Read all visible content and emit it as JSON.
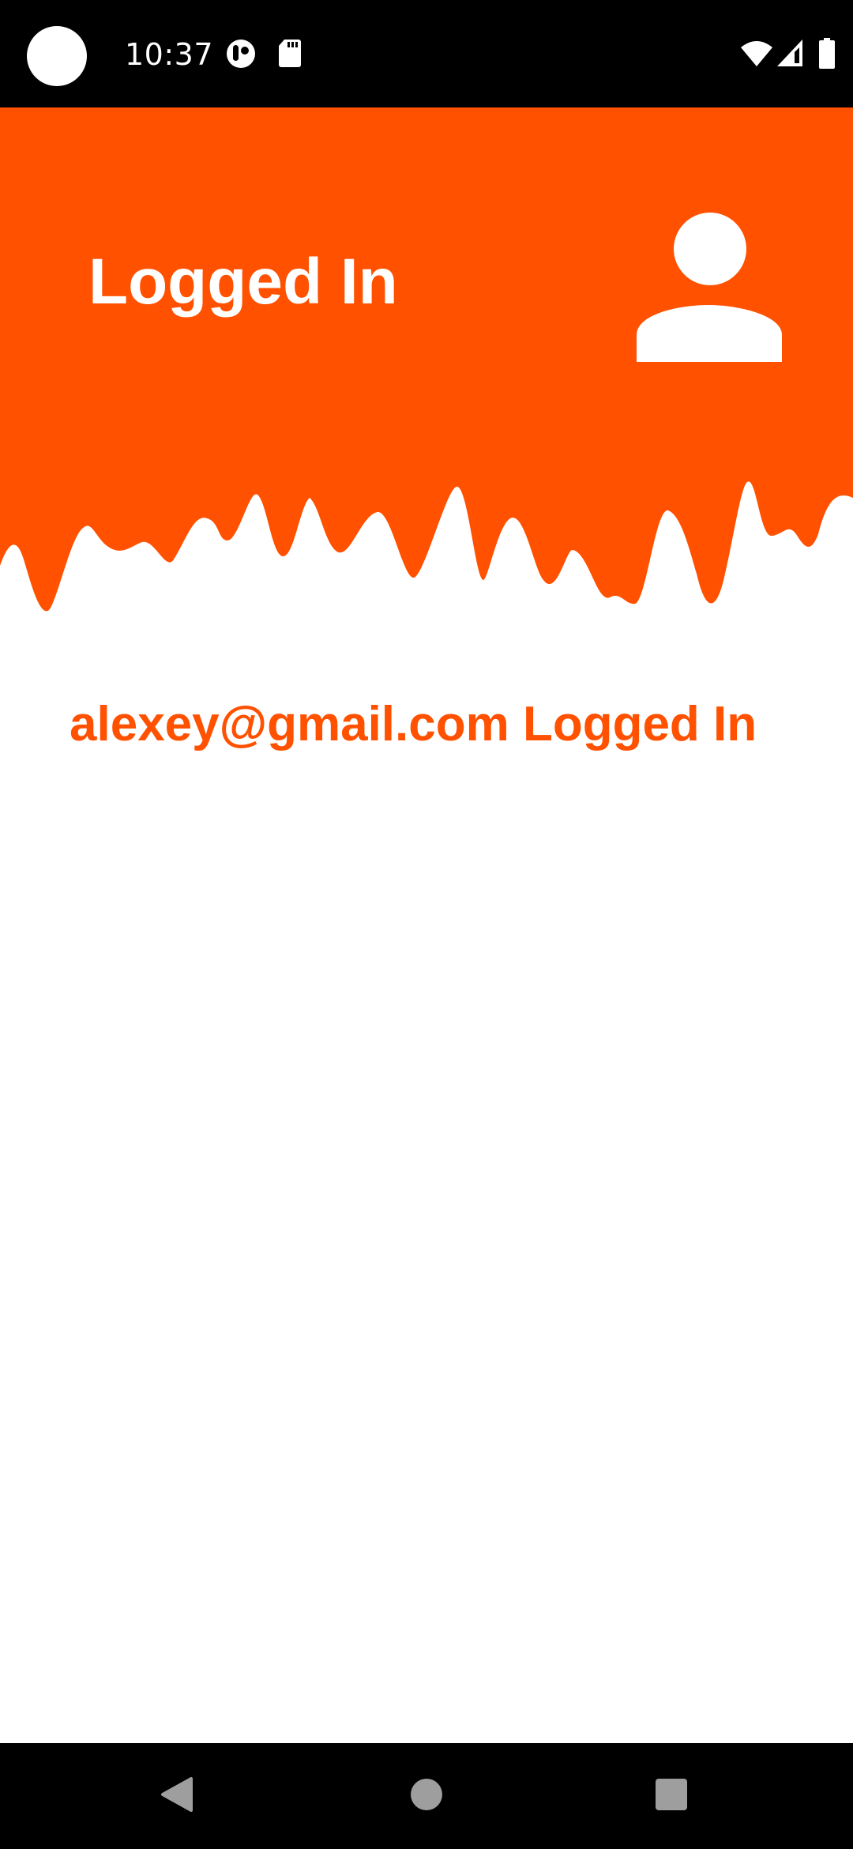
{
  "status_bar": {
    "time": "10:37",
    "icons_left": [
      "pocket-casts-icon",
      "sd-card-icon"
    ],
    "icons_right": [
      "wifi-icon",
      "cell-signal-icon",
      "battery-icon"
    ]
  },
  "header": {
    "title": "Logged In",
    "avatar_icon": "person-icon",
    "background_color": "#ff5100"
  },
  "main": {
    "message": "alexey@gmail.com Logged In",
    "message_color": "#ff5100"
  },
  "nav_bar": {
    "buttons": [
      "back-icon",
      "home-icon",
      "recents-icon"
    ]
  }
}
